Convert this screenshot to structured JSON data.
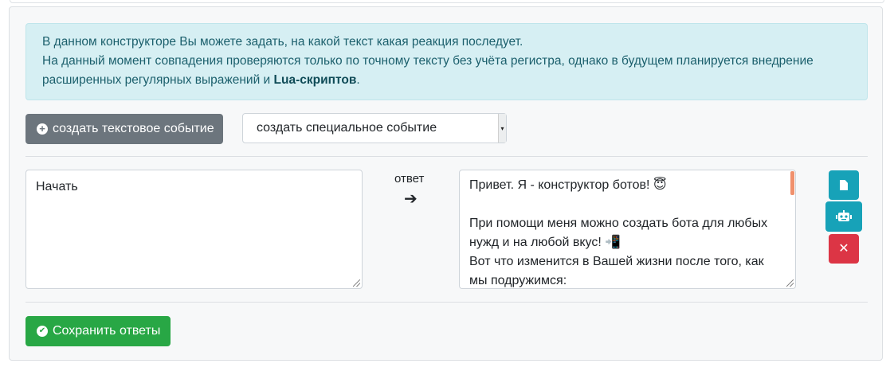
{
  "info_alert": {
    "line1": "В данном конструкторе Вы можете задать, на какой текст какая реакция последует.",
    "line2_a": "На данный момент совпадения проверяются только по точному тексту без учёта регистра, однако в будущем планируется внедрение расширенных регулярных выражений и ",
    "line2_bold": "Lua-скриптов",
    "line2_end": "."
  },
  "toolbar": {
    "create_text_event_label": "создать текстовое событие",
    "special_event_selected": "создать специальное событие"
  },
  "event_row": {
    "trigger_text": "Начать",
    "answer_label": "ответ",
    "response_lines": [
      "Привет. Я - конструктор ботов! 😇",
      "",
      "При помощи меня можно создать бота для любых",
      "нужд и на любой вкус! 📲",
      "Вот что изменится в Вашей жизни после того, как",
      "мы подружимся:"
    ]
  },
  "footer": {
    "save_label": "Сохранить ответы"
  },
  "icons": {
    "plus": "plus-circle-icon",
    "check": "check-circle-icon",
    "arrow": "arrow-right-icon",
    "file": "file-icon",
    "robot": "robot-icon",
    "delete": "close-icon"
  },
  "colors": {
    "secondary": "#6c757d",
    "success": "#28a745",
    "info": "#17a2b8",
    "danger": "#dc3545",
    "alert_bg": "#d6eff3"
  }
}
